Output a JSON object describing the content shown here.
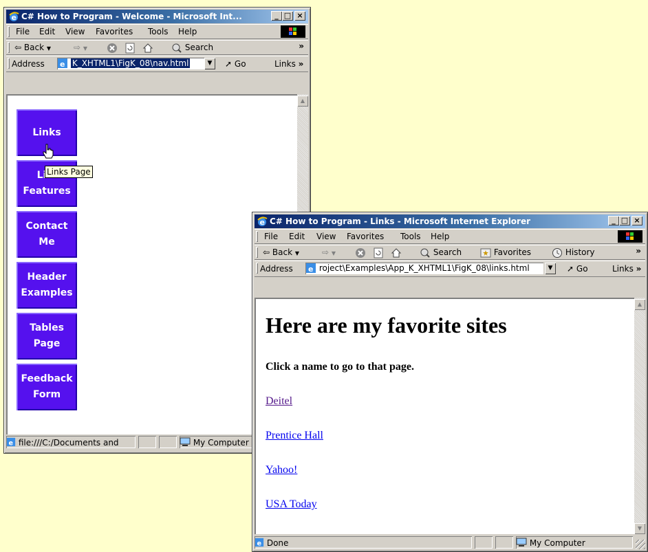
{
  "win1": {
    "title": "C# How to Program - Welcome - Microsoft Int...",
    "menu": [
      "File",
      "Edit",
      "View",
      "Favorites",
      "Tools",
      "Help"
    ],
    "toolbar": {
      "back": "Back",
      "search": "Search"
    },
    "address_label": "Address",
    "address_value": "K_XHTML1\\FigK_08\\nav.html",
    "go_label": "Go",
    "links_label": "Links",
    "nav_buttons": [
      {
        "line1": "Links",
        "line2": ""
      },
      {
        "line1": "List",
        "line2": "Features"
      },
      {
        "line1": "Contact",
        "line2": "Me"
      },
      {
        "line1": "Header",
        "line2": "Examples"
      },
      {
        "line1": "Tables",
        "line2": "Page"
      },
      {
        "line1": "Feedback",
        "line2": "Form"
      }
    ],
    "tooltip": "Links Page",
    "status_text": "file:///C:/Documents and",
    "status_zone": "My Computer"
  },
  "win2": {
    "title": "C# How to Program - Links - Microsoft Internet Explorer",
    "menu": [
      "File",
      "Edit",
      "View",
      "Favorites",
      "Tools",
      "Help"
    ],
    "toolbar": {
      "back": "Back",
      "search": "Search",
      "favorites": "Favorites",
      "history": "History"
    },
    "address_label": "Address",
    "address_value": "roject\\Examples\\App_K_XHTML1\\FigK_08\\links.html",
    "go_label": "Go",
    "links_label": "Links",
    "page": {
      "heading": "Here are my favorite sites",
      "intro": "Click a name to go to that page.",
      "links": [
        "Deitel",
        "Prentice Hall",
        "Yahoo!",
        "USA Today"
      ]
    },
    "status_text": "Done",
    "status_zone": "My Computer"
  }
}
